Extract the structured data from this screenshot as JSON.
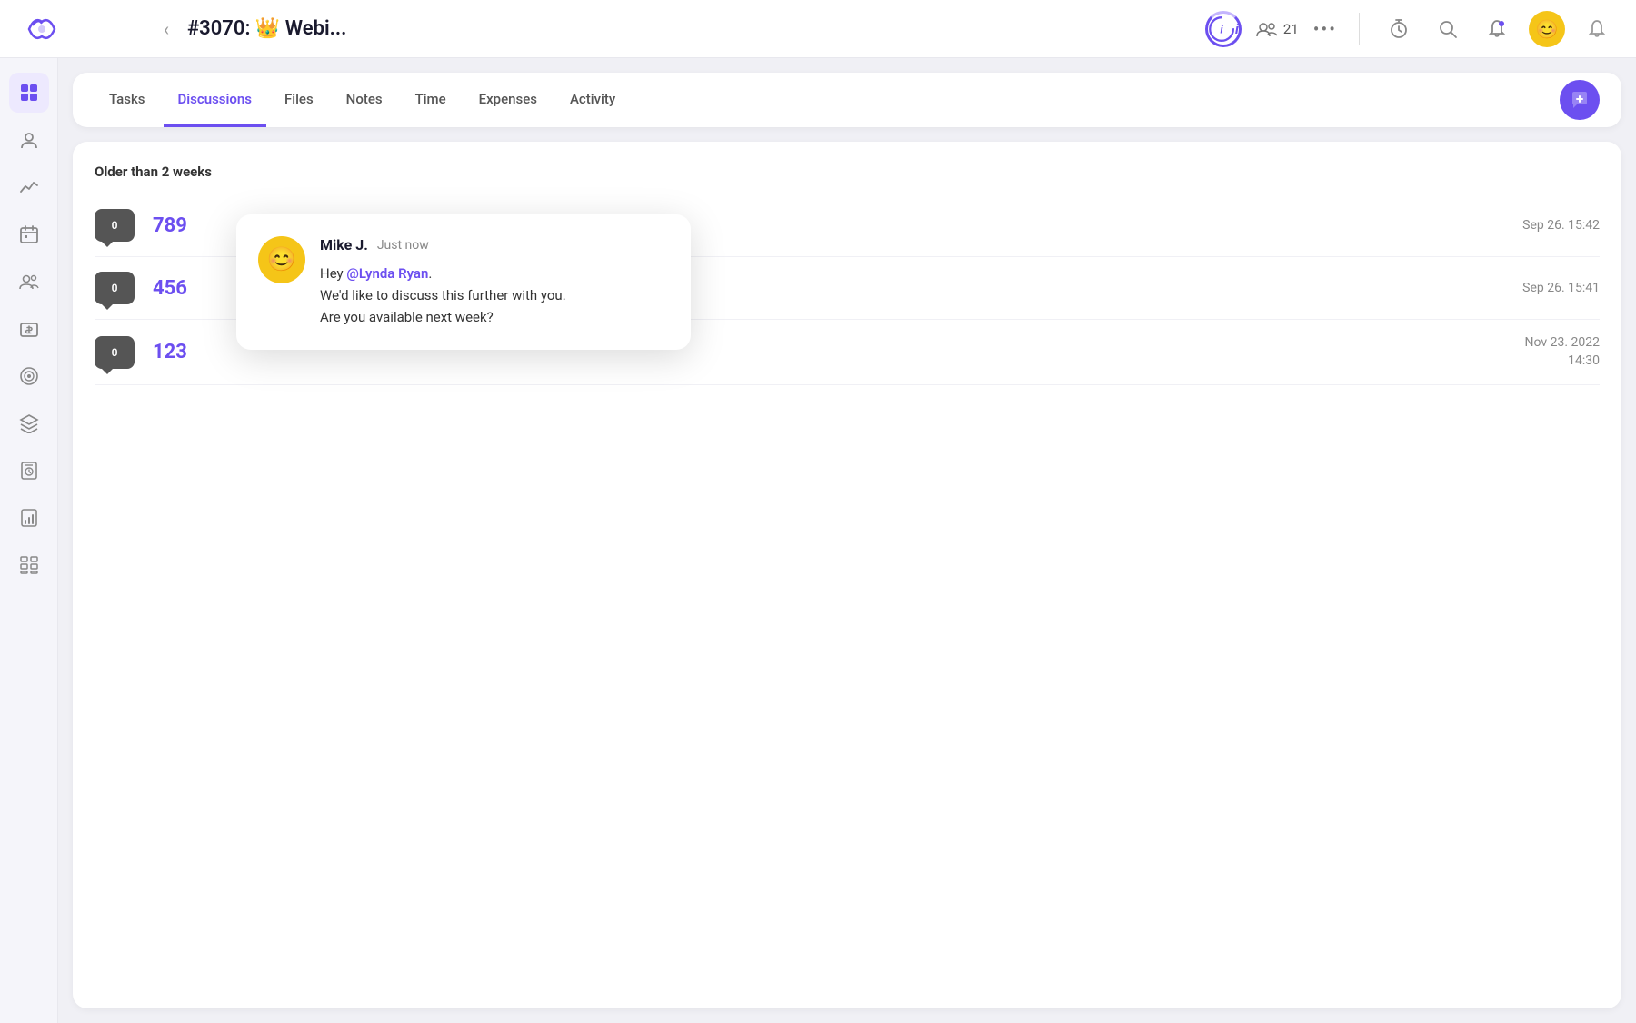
{
  "header": {
    "title": "#3070: 👑 Webi...",
    "members_count": "21",
    "back_label": "‹"
  },
  "tabs": {
    "items": [
      {
        "id": "tasks",
        "label": "Tasks",
        "active": false
      },
      {
        "id": "discussions",
        "label": "Discussions",
        "active": true
      },
      {
        "id": "files",
        "label": "Files",
        "active": false
      },
      {
        "id": "notes",
        "label": "Notes",
        "active": false
      },
      {
        "id": "time",
        "label": "Time",
        "active": false
      },
      {
        "id": "expenses",
        "label": "Expenses",
        "active": false
      },
      {
        "id": "activity",
        "label": "Activity",
        "active": false
      }
    ]
  },
  "discussions": {
    "section_label": "Older than 2 weeks",
    "items": [
      {
        "id": "789",
        "number": "789",
        "comment_count": "0",
        "date": "Sep 26. 15:42"
      },
      {
        "id": "456",
        "number": "456",
        "comment_count": "0",
        "date": "Sep 26. 15:41"
      },
      {
        "id": "123",
        "number": "123",
        "comment_count": "0",
        "date": "Nov 23. 2022\n14:30"
      }
    ]
  },
  "popup": {
    "author": "Mike J.",
    "time": "Just now",
    "message_line1": "Hey ",
    "mention": "@Lynda Ryan",
    "message_line1_end": ".",
    "message_line2": "We'd like to discuss this further with you.",
    "message_line3": "Are you available next week?"
  },
  "sidebar": {
    "items": [
      {
        "id": "grid",
        "icon": "⊞",
        "active": true
      },
      {
        "id": "user",
        "icon": "👤",
        "active": false
      },
      {
        "id": "chart",
        "icon": "📈",
        "active": false
      },
      {
        "id": "calendar",
        "icon": "📅",
        "active": false
      },
      {
        "id": "team",
        "icon": "👥",
        "active": false
      },
      {
        "id": "billing",
        "icon": "💲",
        "active": false
      },
      {
        "id": "target",
        "icon": "🎯",
        "active": false
      },
      {
        "id": "layers",
        "icon": "🗂",
        "active": false
      },
      {
        "id": "timesheet",
        "icon": "🕐",
        "active": false
      },
      {
        "id": "report",
        "icon": "📊",
        "active": false
      },
      {
        "id": "grid2",
        "icon": "⊟",
        "active": false
      }
    ]
  },
  "new_discussion_btn_label": "+",
  "colors": {
    "accent": "#6c4ff0",
    "text_primary": "#1a1a2e",
    "text_secondary": "#555555"
  }
}
